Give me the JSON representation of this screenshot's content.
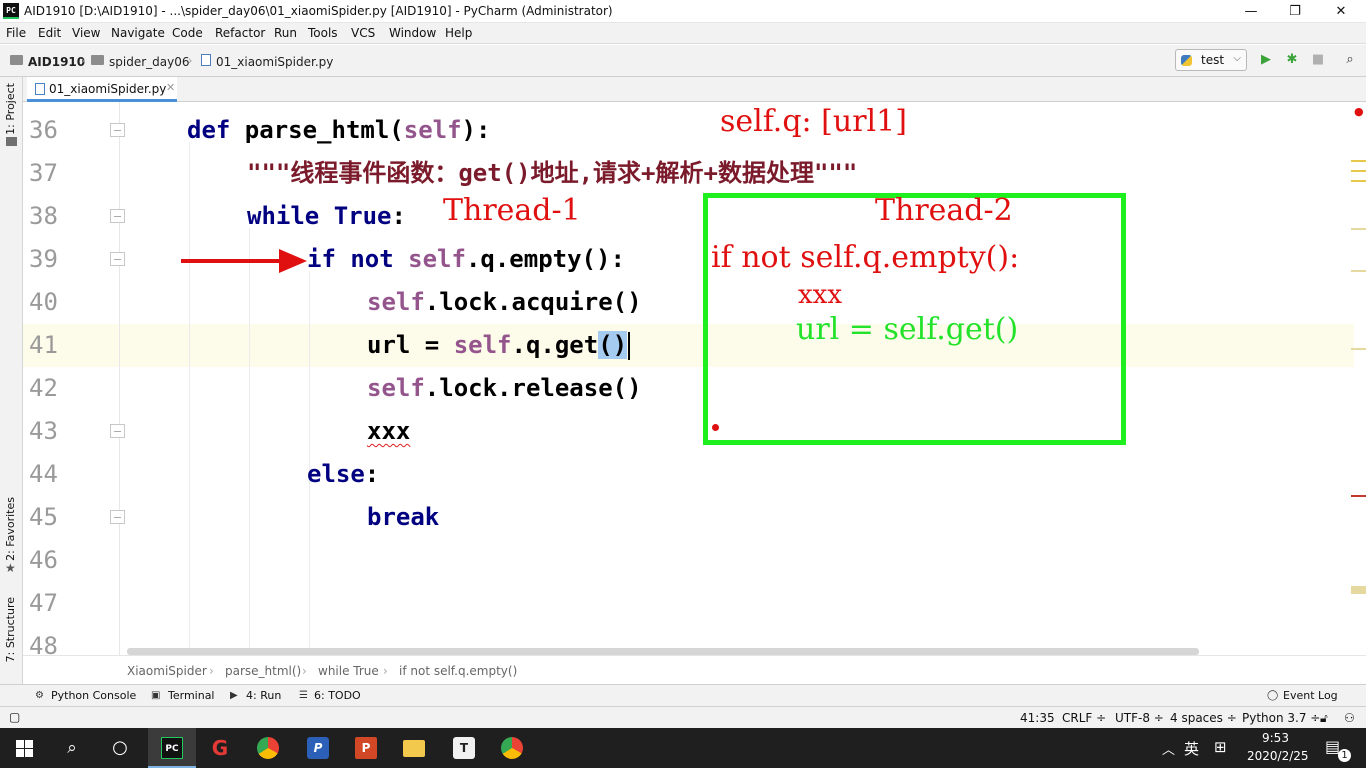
{
  "window": {
    "app_icon": "PC",
    "title": "AID1910 [D:\\AID1910] - ...\\spider_day06\\01_xiaomiSpider.py [AID1910] - PyCharm (Administrator)",
    "minimize": "—",
    "maximize": "❐",
    "close": "✕"
  },
  "menu": [
    "File",
    "Edit",
    "View",
    "Navigate",
    "Code",
    "Refactor",
    "Run",
    "Tools",
    "VCS",
    "Window",
    "Help"
  ],
  "navbar": {
    "crumbs": [
      "AID1910",
      "spider_day06",
      "01_xiaomiSpider.py"
    ],
    "run_config": "test"
  },
  "left_tabs": {
    "project": "1: Project",
    "favorites": "2: Favorites",
    "structure": "7: Structure"
  },
  "file_tab": {
    "name": "01_xiaomiSpider.py",
    "close": "✕"
  },
  "editor": {
    "line_numbers": [
      "36",
      "37",
      "38",
      "39",
      "40",
      "41",
      "42",
      "43",
      "44",
      "45",
      "46",
      "47",
      "48"
    ],
    "code": {
      "l36_kw": "def",
      "l36_fn": " parse_html(",
      "l36_self": "self",
      "l36_end": "):",
      "l37_doc": "\"\"\"线程事件函数：get()地址,请求+解析+数据处理\"\"\"",
      "l38_kw": "while",
      "l38_true": " True",
      "l38_end": ":",
      "l39_kw": "if not",
      "l39_self": " self",
      "l39_end": ".q.empty():",
      "l40_self": "self",
      "l40_end": ".lock.acquire()",
      "l41_url": "url = ",
      "l41_self": "self",
      "l41_mid": ".q.get",
      "l41_sel": "()",
      "l42_self": "self",
      "l42_end": ".lock.release()",
      "l43_xxx": "xxx",
      "l44_kw": "else",
      "l44_end": ":",
      "l45_kw": "break"
    },
    "annotations": {
      "queue_note": "self.q: [url1]",
      "thread1": "Thread-1",
      "thread2": "Thread-2",
      "t2_if": "if not self.q.empty():",
      "t2_xxx": "xxx",
      "t2_url": "url = self.get()",
      "arrow": "⟶"
    }
  },
  "breadcrumb": [
    "XiaomiSpider",
    "parse_html()",
    "while True",
    "if not self.q.empty()"
  ],
  "tool_tabs": [
    "Python Console",
    "Terminal",
    "4: Run",
    "6: TODO"
  ],
  "event_log": "Event Log",
  "status": {
    "position": "41:35",
    "line_sep": "CRLF ÷",
    "encoding": "UTF-8 ÷",
    "indent": "4 spaces ÷",
    "interpreter": "Python 3.7 ÷"
  },
  "taskbar": {
    "ime": "英",
    "time": "9:53",
    "date": "2020/2/25",
    "notif_count": "1"
  }
}
